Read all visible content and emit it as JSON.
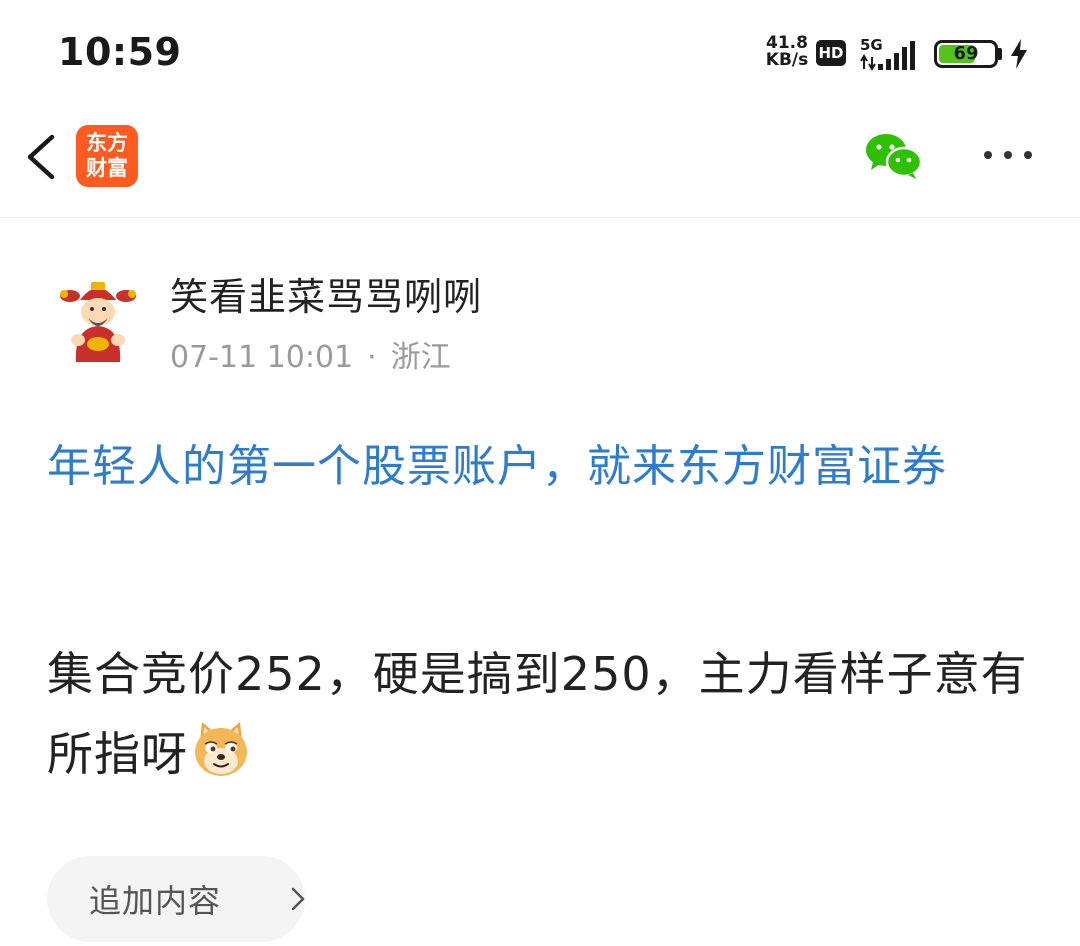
{
  "status_bar": {
    "time": "10:59",
    "net_speed_value": "41.8",
    "net_speed_unit": "KB/s",
    "hd_label": "HD",
    "network_type": "5G",
    "battery_level": 69,
    "battery_text": "69",
    "charging": true
  },
  "nav": {
    "app_logo_line1": "东方",
    "app_logo_line2": "财富",
    "logo_color": "#ff5a1f",
    "share_icon": "wechat-icon",
    "more_icon": "more-dots-icon"
  },
  "post": {
    "author_name": "笑看韭菜骂骂咧咧",
    "date": "07-11 10:01",
    "separator": "·",
    "location": "浙江",
    "promo_link": "年轻人的第一个股票账户，就来东方财富证券",
    "body_text": "集合竞价252，硬是搞到250，主力看样子意有所指呀",
    "body_emoji": "doge-emoji",
    "link_color": "#2f7ccc"
  },
  "actions": {
    "add_content_label": "追加内容"
  }
}
